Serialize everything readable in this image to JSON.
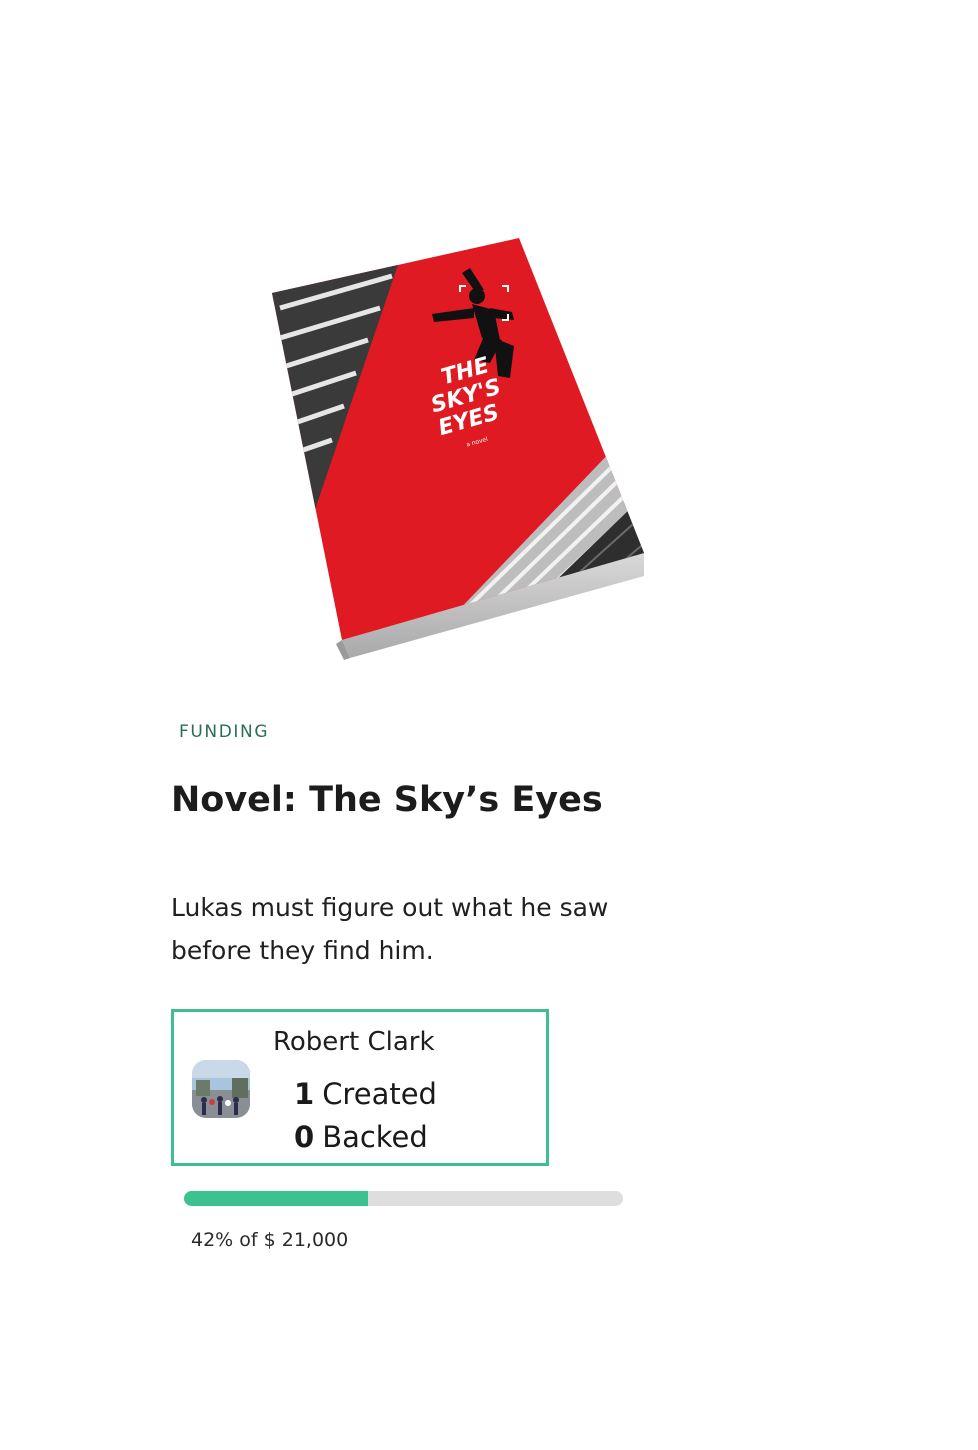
{
  "cover": {
    "title_lines": [
      "THE",
      "SKY'S",
      "EYES"
    ],
    "subtitle": "a novel"
  },
  "project": {
    "category": "FUNDING",
    "title": "Novel: The Sky’s Eyes",
    "description": "Lukas must figure out what he saw before they find him."
  },
  "creator": {
    "name": "Robert Clark",
    "created_count": "1",
    "created_label": "Created",
    "backed_count": "0",
    "backed_label": "Backed"
  },
  "funding": {
    "percent": 42,
    "text": "42% of $ 21,000"
  },
  "colors": {
    "accent": "#3cc28f",
    "category": "#2b6e58",
    "cover_red": "#e01a22"
  }
}
